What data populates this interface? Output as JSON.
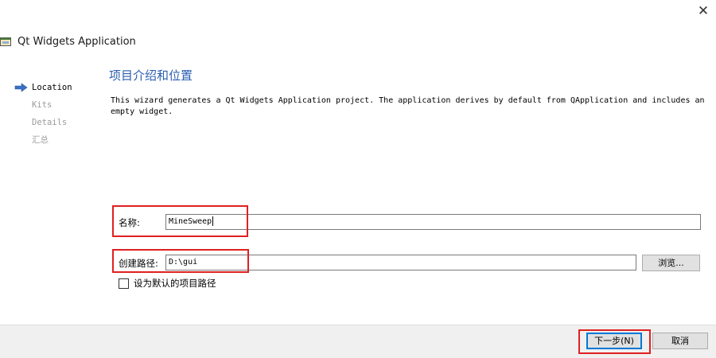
{
  "window": {
    "title": "Qt Widgets Application",
    "close_glyph": "✕",
    "app_icon": "window-icon"
  },
  "steps": [
    {
      "label": "Location",
      "active": true
    },
    {
      "label": "Kits",
      "active": false
    },
    {
      "label": "Details",
      "active": false
    },
    {
      "label": "汇总",
      "active": false
    }
  ],
  "page": {
    "heading": "项目介绍和位置",
    "description": "This wizard generates a Qt Widgets Application project. The application derives by default from QApplication and includes an empty widget."
  },
  "form": {
    "name_label": "名称:",
    "name_value": "MineSweep",
    "path_label": "创建路径:",
    "path_value": "D:\\gui",
    "browse_label": "浏览...",
    "default_path_label": "设为默认的项目路径",
    "default_path_checked": false
  },
  "footer": {
    "next_label": "下一步(N)",
    "cancel_label": "取消"
  },
  "colors": {
    "heading": "#2a5db0",
    "highlight_box": "#e02020",
    "step_arrow": "#3b6fc4"
  }
}
